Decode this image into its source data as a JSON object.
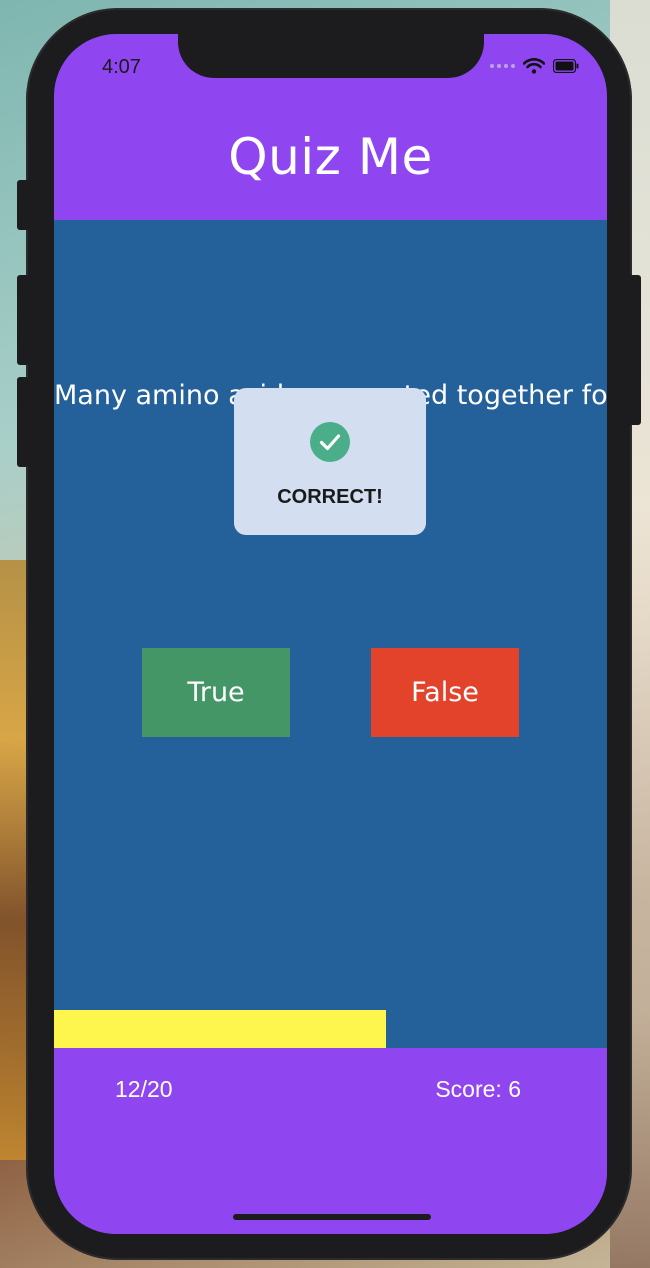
{
  "status_bar": {
    "time": "4:07",
    "icons": [
      "signal-dots-icon",
      "wifi-icon",
      "battery-icon"
    ]
  },
  "header": {
    "title": "Quiz Me"
  },
  "question": {
    "text": "Many amino acids connected together form"
  },
  "popup": {
    "icon": "check-circle-icon",
    "message": "CORRECT!"
  },
  "answers": {
    "true_label": "True",
    "false_label": "False"
  },
  "progress": {
    "fraction": 0.6
  },
  "footer": {
    "counter": "12/20",
    "score": "Score: 6"
  },
  "colors": {
    "header_bg": "#8f46f0",
    "main_bg": "#24609a",
    "true_button": "#449667",
    "false_button": "#e2432a",
    "progress_fill": "#fff64d",
    "popup_bg": "#d3dff0",
    "check_icon": "#4bae8a"
  }
}
